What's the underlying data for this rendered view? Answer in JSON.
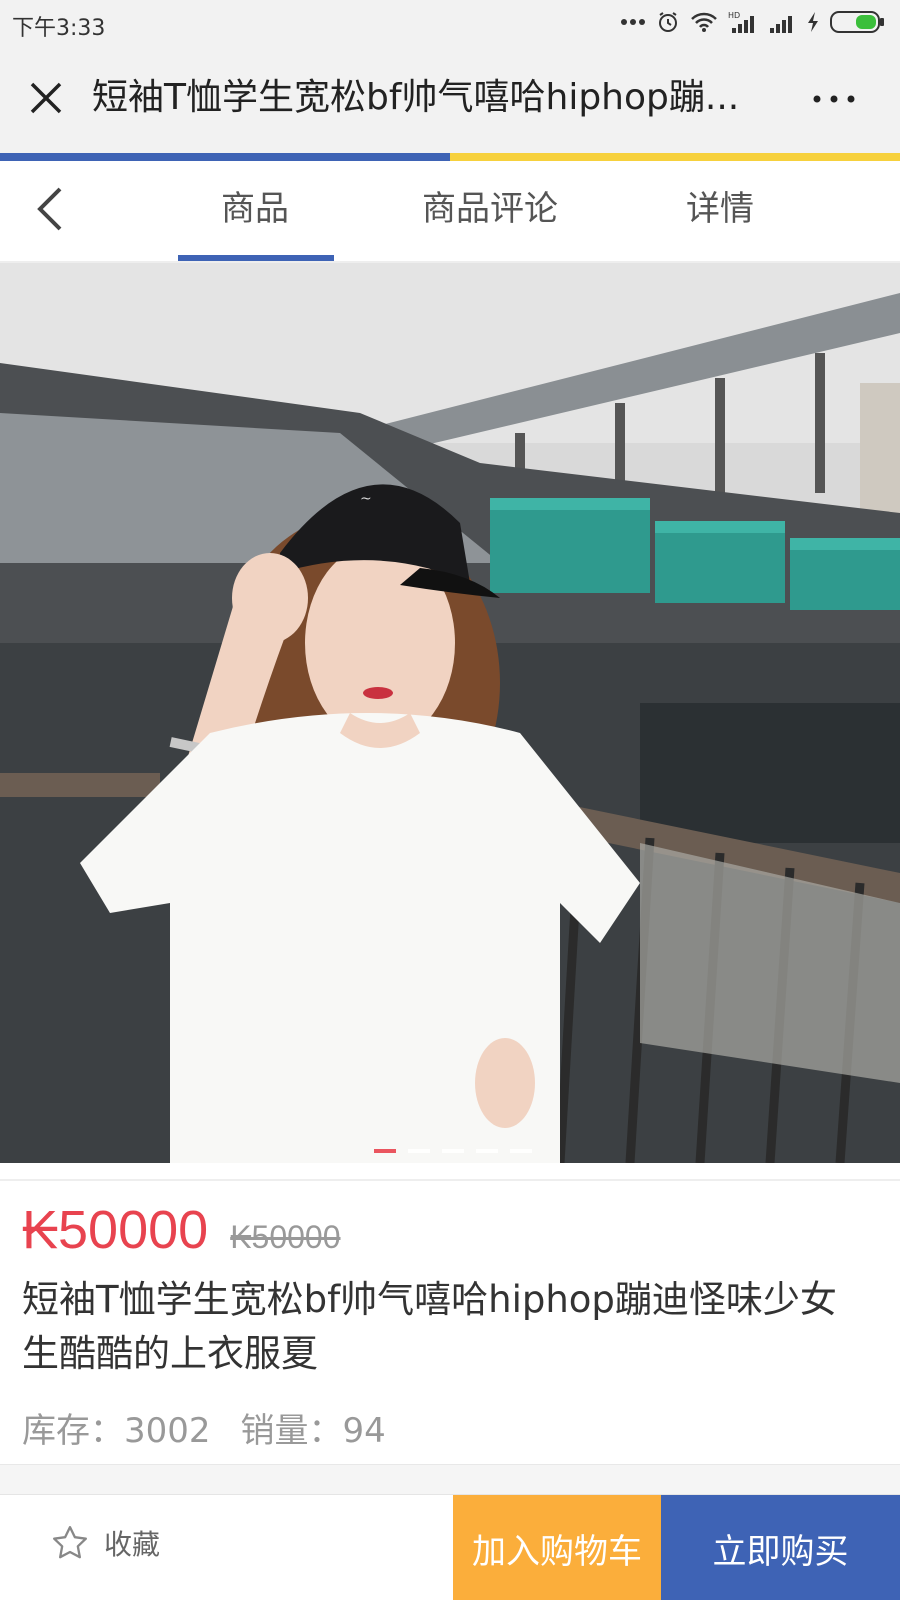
{
  "status_bar": {
    "time": "下午3:33",
    "signal_label": "HD",
    "icons": [
      "more-dots-icon",
      "alarm-icon",
      "wifi-icon",
      "hd-signal-icon",
      "signal-icon",
      "charging-icon",
      "battery-icon"
    ]
  },
  "title_bar": {
    "title": "短袖T恤学生宽松bf帅气嘻哈hiphop蹦...",
    "more_label": "···"
  },
  "tabs": [
    {
      "label": "商品",
      "active": true
    },
    {
      "label": "商品评论",
      "active": false
    },
    {
      "label": "详情",
      "active": false
    }
  ],
  "gallery": {
    "total": 5,
    "current": 1
  },
  "product": {
    "price": "₭50000",
    "old_price": "₭50000",
    "name": "短袖T恤学生宽松bf帅气嘻哈hiphop蹦迪怪味少女生酷酷的上衣服夏",
    "stock": "库存：3002",
    "sales": "销量：94"
  },
  "actions": {
    "favorite_label": "收藏",
    "add_to_cart_label": "加入购物车",
    "buy_now_label": "立即购买"
  },
  "colors": {
    "accent_blue": "#3e63b5",
    "accent_yellow": "#f7d13d",
    "price_red": "#e8434f",
    "cart_orange": "#fbae3b"
  }
}
